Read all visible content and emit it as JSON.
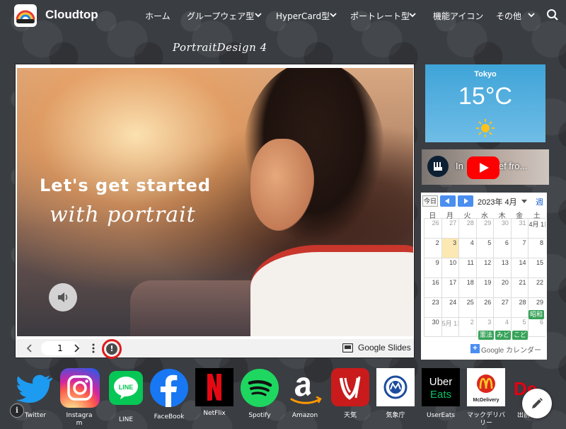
{
  "header": {
    "brand": "Cloudtop",
    "nav": [
      {
        "label": "ホーム",
        "dropdown": false
      },
      {
        "label": "グループウェア型",
        "dropdown": true
      },
      {
        "label": "HyperCard型",
        "dropdown": true
      },
      {
        "label": "ポートレート型",
        "dropdown": true
      },
      {
        "label": "機能アイコン",
        "dropdown": false
      },
      {
        "label": "その他",
        "dropdown": true
      }
    ]
  },
  "page_title": "PortraitDesign 4",
  "slides": {
    "headline_1": "Let's get started",
    "headline_2": "with portrait",
    "page_number": "1",
    "provider_label": "Google Slides"
  },
  "weather": {
    "city": "Tokyo",
    "temperature": "15°C",
    "condition_icon": "sun-icon"
  },
  "youtube": {
    "title_start": "In",
    "title_end": "ef fro..."
  },
  "calendar": {
    "today_label": "今日",
    "month": "2023年 4月",
    "week_label": "週",
    "weekdays": [
      "日",
      "月",
      "火",
      "水",
      "木",
      "金",
      "土"
    ],
    "weeks": [
      [
        "26",
        "27",
        "28",
        "29",
        "30",
        "31",
        "4月 1日"
      ],
      [
        "2",
        "3",
        "4",
        "5",
        "6",
        "7",
        "8"
      ],
      [
        "9",
        "10",
        "11",
        "12",
        "13",
        "14",
        "15"
      ],
      [
        "16",
        "17",
        "18",
        "19",
        "20",
        "21",
        "22"
      ],
      [
        "23",
        "24",
        "25",
        "26",
        "27",
        "28",
        "29"
      ],
      [
        "30",
        "5月 1日",
        "2",
        "3",
        "4",
        "5",
        "6"
      ]
    ],
    "events": [
      {
        "label": "昭和"
      },
      {
        "label": "憲法"
      },
      {
        "label": "みど"
      },
      {
        "label": "こど"
      }
    ],
    "footer_label": "Google カレンダー",
    "accent_color": "#4a8ef0",
    "event_color": "#38a35a"
  },
  "dock": [
    {
      "label": "Twitter",
      "icon": "twitter-icon"
    },
    {
      "label": "Instagram",
      "icon": "instagram-icon"
    },
    {
      "label": "LINE",
      "icon": "line-icon"
    },
    {
      "label": "FaceBook",
      "icon": "facebook-icon"
    },
    {
      "label": "NetFlix",
      "icon": "netflix-icon"
    },
    {
      "label": "Spotify",
      "icon": "spotify-icon"
    },
    {
      "label": "Amazon",
      "icon": "amazon-icon"
    },
    {
      "label": "天気",
      "icon": "weather-app-icon"
    },
    {
      "label": "気象庁",
      "icon": "jma-icon"
    },
    {
      "label": "UserEats",
      "icon": "ubereats-icon"
    },
    {
      "label": "マックデリバリー",
      "icon": "mcdelivery-icon"
    },
    {
      "label": "出前",
      "icon": "demaecan-icon"
    }
  ],
  "app_icon_texts": {
    "line": "LINE",
    "uber_1": "Uber",
    "uber_2": "Eats",
    "mcd": "McDelivery",
    "demae": "De"
  }
}
